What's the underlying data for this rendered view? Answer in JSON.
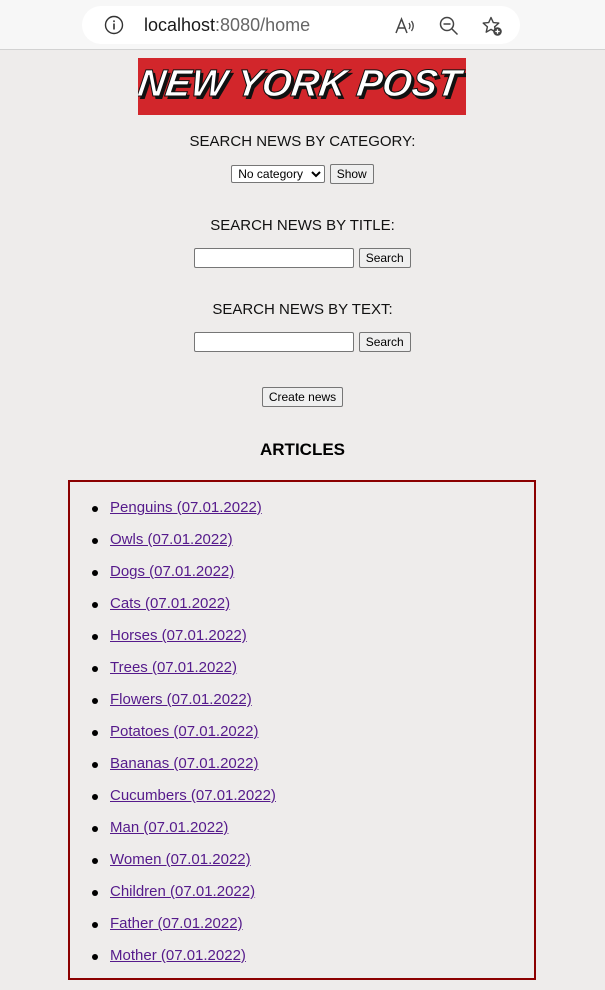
{
  "browser": {
    "url_host": "localhost",
    "url_rest": ":8080/home"
  },
  "logo_text": "NEW YORK POST",
  "category_search": {
    "label": "SEARCH NEWS BY CATEGORY:",
    "selected": "No category",
    "button": "Show"
  },
  "title_search": {
    "label": "SEARCH NEWS BY TITLE:",
    "value": "",
    "button": "Search"
  },
  "text_search": {
    "label": "SEARCH NEWS BY TEXT:",
    "value": "",
    "button": "Search"
  },
  "create_button": "Create news",
  "articles_heading": "ARTICLES",
  "articles": [
    "Penguins (07.01.2022)",
    "Owls (07.01.2022)",
    "Dogs (07.01.2022)",
    "Cats (07.01.2022)",
    "Horses (07.01.2022)",
    "Trees (07.01.2022)",
    "Flowers (07.01.2022)",
    "Potatoes (07.01.2022)",
    "Bananas (07.01.2022)",
    "Cucumbers (07.01.2022)",
    "Man (07.01.2022)",
    "Women (07.01.2022)",
    "Children (07.01.2022)",
    "Father (07.01.2022)",
    "Mother (07.01.2022)"
  ],
  "colors": {
    "logo_bg": "#d2262b",
    "box_border": "#8b0000",
    "link": "#551a8b"
  }
}
